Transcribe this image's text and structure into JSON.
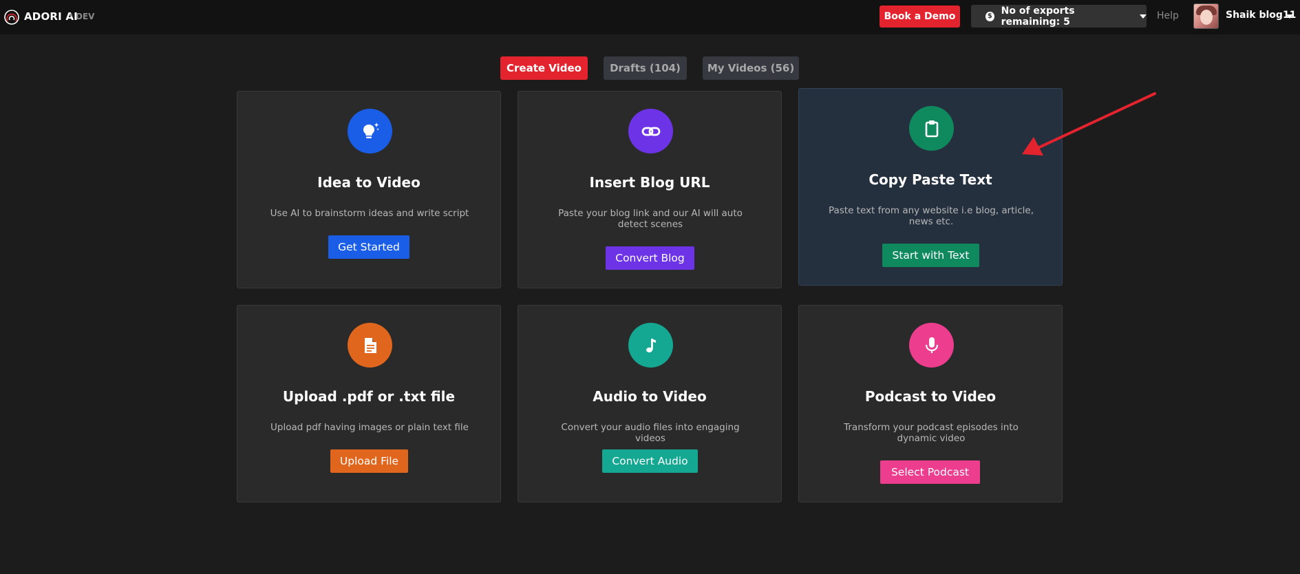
{
  "header": {
    "brand": "ADORI AI",
    "separator": "•",
    "env": "DEV",
    "demo_label": "Book a Demo",
    "exports_label": "No of exports remaining: 5",
    "exports_icon": "dollar-icon",
    "help_label": "Help",
    "username": "Shaik blog11"
  },
  "tabs": [
    {
      "label": "Create Video",
      "active": true
    },
    {
      "label": "Drafts (104)",
      "active": false
    },
    {
      "label": "My Videos (56)",
      "active": false
    }
  ],
  "cards": [
    {
      "title": "Idea to Video",
      "desc": "Use AI to brainstorm ideas and write script",
      "button": "Get Started",
      "icon": "lightbulb-icon",
      "color": "#1a5ee8"
    },
    {
      "title": "Insert Blog URL",
      "desc": "Paste your blog link and our AI will auto detect scenes",
      "button": "Convert Blog",
      "icon": "link-icon",
      "color": "#6c34e6"
    },
    {
      "title": "Copy Paste Text",
      "desc": "Paste text from any website i.e blog, article, news etc.",
      "button": "Start with Text",
      "icon": "clipboard-icon",
      "color": "#0f8a5f"
    },
    {
      "title": "Upload .pdf or .txt file",
      "desc": "Upload pdf having images or plain text file",
      "button": "Upload File",
      "icon": "file-icon",
      "color": "#e0661e"
    },
    {
      "title": "Audio to Video",
      "desc": "Convert your audio files into engaging videos",
      "button": "Convert Audio",
      "icon": "music-note-icon",
      "color": "#14a892"
    },
    {
      "title": "Podcast to Video",
      "desc": "Transform your podcast episodes into dynamic video",
      "button": "Select Podcast",
      "icon": "microphone-icon",
      "color": "#ec3d8f"
    }
  ],
  "colors": {
    "accent": "#e3232d",
    "highlight_card": "#25303f",
    "annotation_arrow": "#e3232d"
  }
}
